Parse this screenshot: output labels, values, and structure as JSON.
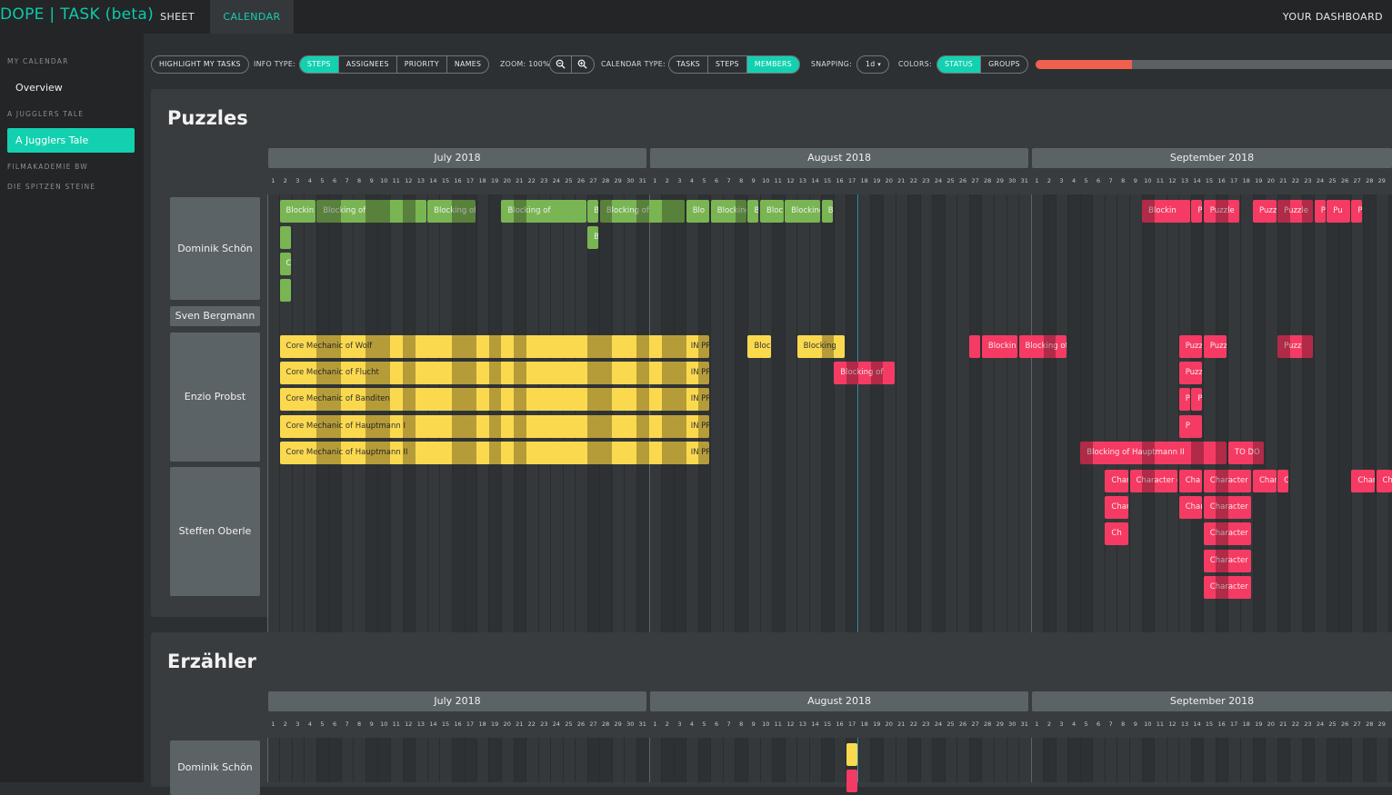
{
  "app": {
    "title": "DOPE | TASK (beta)",
    "tabs": [
      "SHEET",
      "CALENDAR"
    ],
    "active_tab": "CALENDAR",
    "dashboard": "YOUR DASHBOARD"
  },
  "sidebar": {
    "headers": [
      "MY CALENDAR",
      "A JUGGLERS TALE",
      "FILMAKADEMIE BW",
      "DIE SPITZEN STEINE"
    ],
    "overview": "Overview",
    "active_project": "A Jugglers Tale"
  },
  "toolbar": {
    "highlight": "HIGHLIGHT MY TASKS",
    "info_type_label": "INFO TYPE:",
    "info_types": [
      "STEPS",
      "ASSIGNEES",
      "PRIORITY",
      "NAMES"
    ],
    "info_type_selected": "STEPS",
    "zoom_label": "ZOOM: 100%",
    "zoom_out_icon": "zoom-out-icon",
    "zoom_in_icon": "zoom-in-icon",
    "calendar_type_label": "CALENDAR TYPE:",
    "calendar_types": [
      "TASKS",
      "STEPS",
      "MEMBERS"
    ],
    "calendar_type_selected": "MEMBERS",
    "snapping_label": "SNAPPING:",
    "snapping_value": "1d",
    "colors_label": "COLORS:",
    "colors": [
      "STATUS",
      "GROUPS"
    ],
    "colors_selected": "STATUS",
    "progress": 0.27,
    "colors_palette": {
      "accent": "#13d1b0",
      "green": "#7ab553",
      "yellow": "#fbd94f",
      "red": "#f53b63",
      "progress": "#f0604f"
    }
  },
  "months": [
    "July 2018",
    "August 2018",
    "September 2018"
  ],
  "groups": [
    {
      "title": "Puzzles",
      "members": [
        {
          "name": "Dominik Schön",
          "bars": [
            {
              "row": 0,
              "s": 1,
              "e": 4,
              "c": "g",
              "label": "Blockin"
            },
            {
              "row": 0,
              "s": 4,
              "e": 13,
              "c": "g",
              "label": "Blocking of"
            },
            {
              "row": 0,
              "s": 13,
              "e": 17,
              "c": "g",
              "label": "Blocking of"
            },
            {
              "row": 0,
              "s": 19,
              "e": 26,
              "c": "g",
              "label": "Blocking of"
            },
            {
              "row": 0,
              "s": 26,
              "e": 27,
              "c": "g",
              "label": "B"
            },
            {
              "row": 0,
              "s": 27,
              "e": 34,
              "c": "g",
              "label": "Blocking of"
            },
            {
              "row": 0,
              "s": 34,
              "e": 36,
              "c": "g",
              "label": "Blo"
            },
            {
              "row": 0,
              "s": 36,
              "e": 39,
              "c": "g",
              "label": "Blocking"
            },
            {
              "row": 0,
              "s": 39,
              "e": 40,
              "c": "g",
              "label": "B"
            },
            {
              "row": 0,
              "s": 40,
              "e": 42,
              "c": "g",
              "label": "Bloc"
            },
            {
              "row": 0,
              "s": 42,
              "e": 45,
              "c": "g",
              "label": "Blocking"
            },
            {
              "row": 0,
              "s": 45,
              "e": 46,
              "c": "g",
              "label": "B"
            },
            {
              "row": 1,
              "s": 1,
              "e": 2,
              "c": "g",
              "label": ""
            },
            {
              "row": 1,
              "s": 26,
              "e": 27,
              "c": "g",
              "label": "B"
            },
            {
              "row": 2,
              "s": 1,
              "e": 2,
              "c": "g",
              "label": "C"
            },
            {
              "row": 3,
              "s": 1,
              "e": 2,
              "c": "g",
              "label": ""
            },
            {
              "row": 0,
              "s": 71,
              "e": 75,
              "c": "p",
              "label": "Blockin"
            },
            {
              "row": 0,
              "s": 75,
              "e": 76,
              "c": "p",
              "label": "P"
            },
            {
              "row": 0,
              "s": 76,
              "e": 79,
              "c": "p",
              "label": "Puzzle"
            },
            {
              "row": 0,
              "s": 80,
              "e": 82,
              "c": "p",
              "label": "Puzz"
            },
            {
              "row": 0,
              "s": 82,
              "e": 85,
              "c": "p",
              "label": "Puzzle"
            },
            {
              "row": 0,
              "s": 85,
              "e": 86,
              "c": "p",
              "label": "P"
            },
            {
              "row": 0,
              "s": 86,
              "e": 88,
              "c": "p",
              "label": "Pu"
            },
            {
              "row": 0,
              "s": 88,
              "e": 89,
              "c": "p",
              "label": "Pu"
            }
          ]
        },
        {
          "name": "Sven Bergmann",
          "bars": []
        },
        {
          "name": "Enzio Probst",
          "bars": [
            {
              "row": 0,
              "s": 1,
              "e": 36,
              "c": "y",
              "label": "Core Mechanic of Wolf",
              "status": "IN PROGRESS"
            },
            {
              "row": 0,
              "s": 39,
              "e": 41,
              "c": "y",
              "label": "Bloc"
            },
            {
              "row": 0,
              "s": 43,
              "e": 47,
              "c": "y",
              "label": "Blocking"
            },
            {
              "row": 0,
              "s": 57,
              "e": 58,
              "c": "p",
              "label": ""
            },
            {
              "row": 0,
              "s": 58,
              "e": 61,
              "c": "p",
              "label": "Blockin"
            },
            {
              "row": 0,
              "s": 61,
              "e": 65,
              "c": "p",
              "label": "Blocking of"
            },
            {
              "row": 0,
              "s": 74,
              "e": 76,
              "c": "p",
              "label": "Puzz"
            },
            {
              "row": 0,
              "s": 76,
              "e": 78,
              "c": "p",
              "label": "Puzz"
            },
            {
              "row": 0,
              "s": 82,
              "e": 85,
              "c": "p",
              "label": "Puzz"
            },
            {
              "row": 1,
              "s": 1,
              "e": 36,
              "c": "y",
              "label": "Core Mechanic of Flucht",
              "status": "IN PROGRESS"
            },
            {
              "row": 1,
              "s": 46,
              "e": 51,
              "c": "p",
              "label": "Blocking of"
            },
            {
              "row": 1,
              "s": 74,
              "e": 76,
              "c": "p",
              "label": "Puzz"
            },
            {
              "row": 2,
              "s": 1,
              "e": 36,
              "c": "y",
              "label": "Core Mechanic of Banditen",
              "status": "IN PROGRESS"
            },
            {
              "row": 2,
              "s": 74,
              "e": 75,
              "c": "p",
              "label": "P"
            },
            {
              "row": 2,
              "s": 75,
              "e": 76,
              "c": "p",
              "label": "Puz"
            },
            {
              "row": 3,
              "s": 1,
              "e": 36,
              "c": "y",
              "label": "Core Mechanic of Hauptmann I",
              "status": "IN PROGRESS"
            },
            {
              "row": 3,
              "s": 74,
              "e": 76,
              "c": "p",
              "label": "P"
            },
            {
              "row": 4,
              "s": 1,
              "e": 36,
              "c": "y",
              "label": "Core Mechanic of Hauptmann II",
              "status": "IN PROGRESS"
            },
            {
              "row": 4,
              "s": 66,
              "e": 78,
              "c": "p",
              "label": "Blocking of Hauptmann II"
            },
            {
              "row": 4,
              "s": 78,
              "e": 81,
              "c": "p",
              "label": "TO DO"
            }
          ]
        },
        {
          "name": "Steffen Oberle",
          "bars": [
            {
              "row": 0,
              "s": 68,
              "e": 70,
              "c": "p",
              "label": "Char"
            },
            {
              "row": 0,
              "s": 70,
              "e": 74,
              "c": "p",
              "label": "Character of"
            },
            {
              "row": 0,
              "s": 74,
              "e": 76,
              "c": "p",
              "label": "Cha"
            },
            {
              "row": 0,
              "s": 76,
              "e": 80,
              "c": "p",
              "label": "Character of"
            },
            {
              "row": 0,
              "s": 80,
              "e": 82,
              "c": "p",
              "label": "Char"
            },
            {
              "row": 0,
              "s": 82,
              "e": 83,
              "c": "p",
              "label": "Char"
            },
            {
              "row": 0,
              "s": 88,
              "e": 90,
              "c": "p",
              "label": "Char"
            },
            {
              "row": 0,
              "s": 90,
              "e": 92,
              "c": "p",
              "label": "Char"
            },
            {
              "row": 0,
              "s": 92,
              "e": 93,
              "c": "p",
              "label": "C"
            },
            {
              "row": 1,
              "s": 68,
              "e": 70,
              "c": "p",
              "label": "Char"
            },
            {
              "row": 1,
              "s": 74,
              "e": 76,
              "c": "p",
              "label": "Char"
            },
            {
              "row": 1,
              "s": 76,
              "e": 80,
              "c": "p",
              "label": "Character of"
            },
            {
              "row": 2,
              "s": 68,
              "e": 70,
              "c": "p",
              "label": "Ch"
            },
            {
              "row": 2,
              "s": 76,
              "e": 80,
              "c": "p",
              "label": "Character o"
            },
            {
              "row": 3,
              "s": 76,
              "e": 80,
              "c": "p",
              "label": "Character of"
            },
            {
              "row": 4,
              "s": 76,
              "e": 80,
              "c": "p",
              "label": "Character of"
            }
          ]
        }
      ]
    },
    {
      "title": "Erzähler",
      "members": [
        {
          "name": "Dominik Schön",
          "bars": [
            {
              "row": 0,
              "s": 47,
              "e": 48,
              "c": "y",
              "label": ""
            },
            {
              "row": 1,
              "s": 47,
              "e": 48,
              "c": "p",
              "label": ""
            }
          ]
        }
      ]
    }
  ]
}
